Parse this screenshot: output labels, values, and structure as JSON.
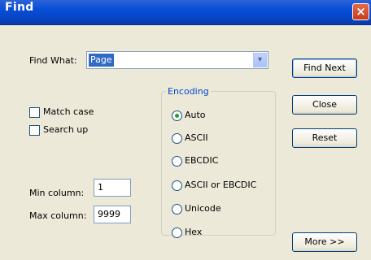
{
  "window": {
    "title": "Find",
    "close_glyph": "×"
  },
  "find_what": {
    "label": "Find What:",
    "value": "Page",
    "dropdown_glyph": "▾"
  },
  "options": {
    "match_case": {
      "label": "Match case",
      "checked": false
    },
    "search_up": {
      "label": "Search up",
      "checked": false
    }
  },
  "encoding": {
    "title": "Encoding",
    "options": [
      "Auto",
      "ASCII",
      "EBCDIC",
      "ASCII or EBCDIC",
      "Unicode",
      "Hex"
    ],
    "selected": "Auto"
  },
  "columns": {
    "min": {
      "label": "Min column:",
      "value": "1"
    },
    "max": {
      "label": "Max column:",
      "value": "9999"
    }
  },
  "buttons": {
    "find_next": "Find Next",
    "close": "Close",
    "reset": "Reset",
    "more": "More >>"
  },
  "colors": {
    "titlebar": "#0646c8",
    "dialog_bg": "#ece9d8",
    "selection": "#316ac5",
    "radio_selected": "#21a121",
    "group_title": "#0046d5"
  },
  "icons": {
    "close": "close-icon",
    "dropdown": "chevron-down-icon"
  }
}
